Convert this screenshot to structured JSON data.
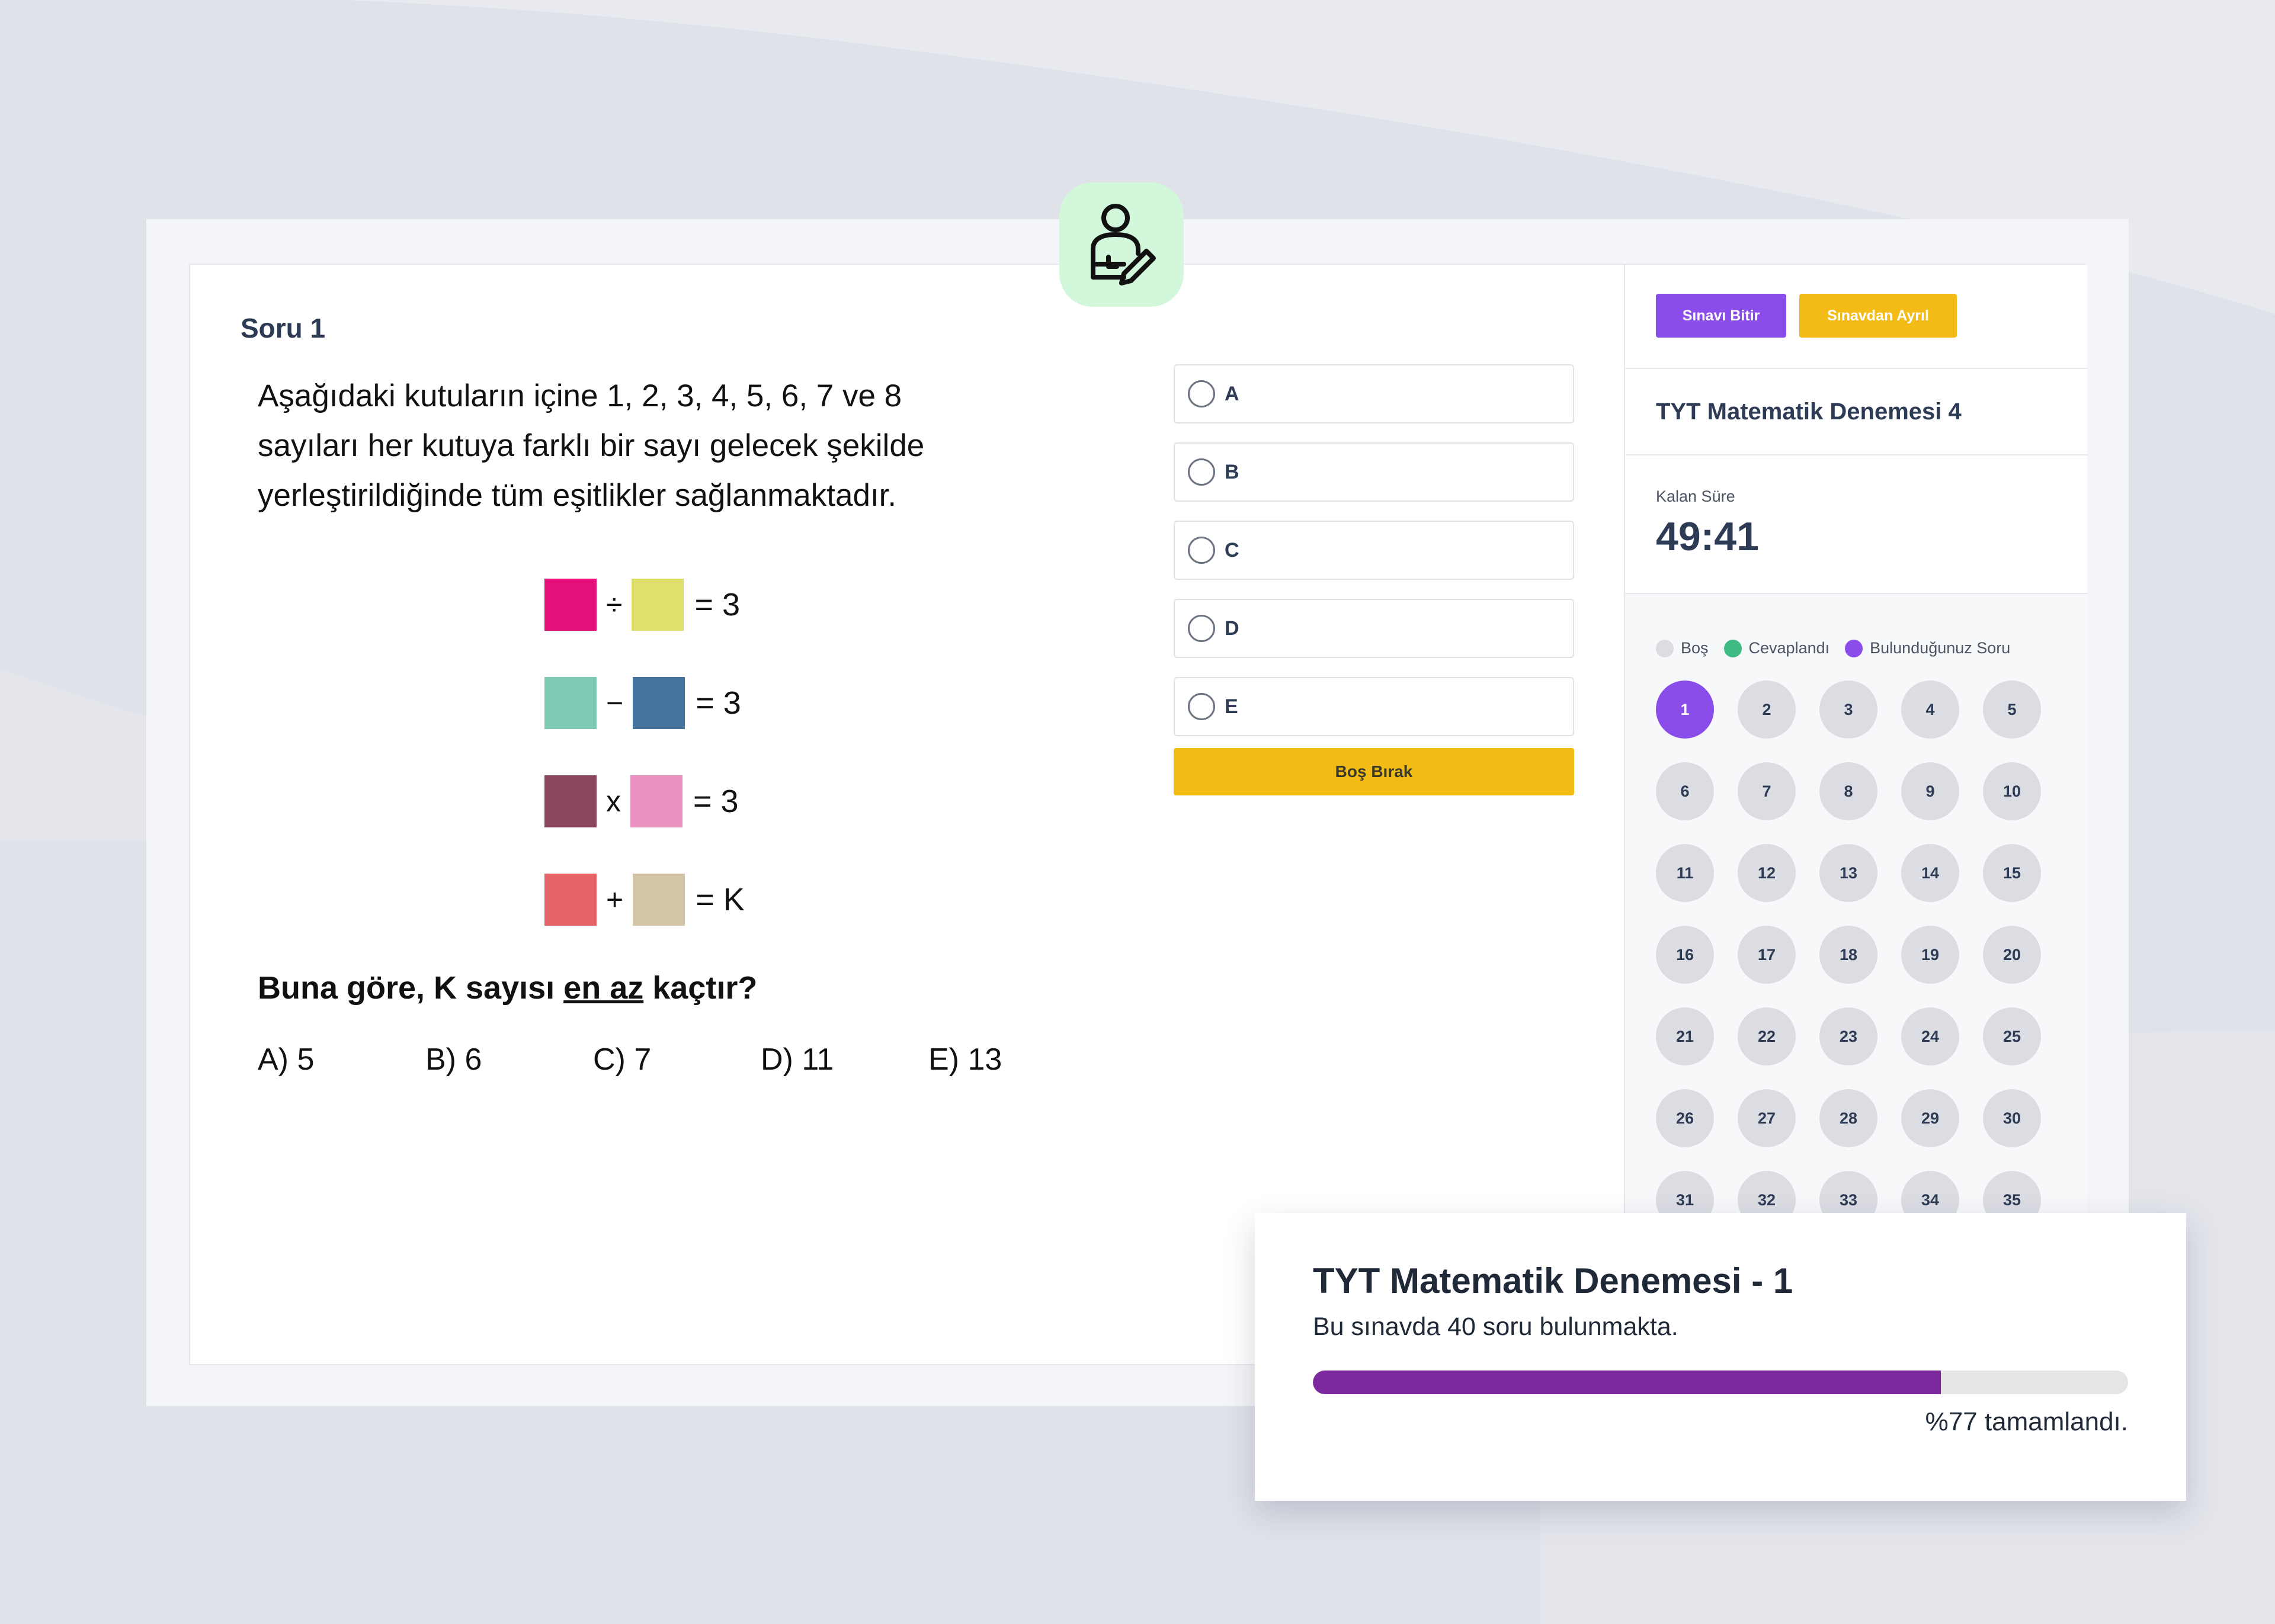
{
  "question": {
    "title": "Soru 1",
    "text": "Aşağıdaki kutuların içine 1, 2, 3, 4, 5, 6, 7 ve 8 sayıları her kutuya farklı bir sayı gelecek şekilde yerleştirildiğinde tüm eşitlikler sağlanmaktadır.",
    "equations": [
      {
        "left_color": "#e3107b",
        "op": "÷",
        "right_color": "#dfe06b",
        "result": "= 3"
      },
      {
        "left_color": "#7fc8b4",
        "op": "−",
        "right_color": "#46749f",
        "result": "= 3"
      },
      {
        "left_color": "#8b4660",
        "op": "x",
        "right_color": "#e891bf",
        "result": "= 3"
      },
      {
        "left_color": "#e46468",
        "op": "+",
        "right_color": "#d5c5a8",
        "result": "= K"
      }
    ],
    "prompt_before": "Buna göre, K sayısı ",
    "prompt_underlined": "en az",
    "prompt_after": " kaçtır?",
    "choices": [
      "A)  5",
      "B)  6",
      "C)  7",
      "D)  11",
      "E)  13"
    ]
  },
  "options": [
    "A",
    "B",
    "C",
    "D",
    "E"
  ],
  "skip_label": "Boş Bırak",
  "sidebar": {
    "finish_label": "Sınavı Bitir",
    "leave_label": "Sınavdan Ayrıl",
    "exam_title": "TYT Matematik Denemesi 4",
    "timer_label": "Kalan Süre",
    "timer_value": "49:41",
    "legend": [
      {
        "label": "Boş",
        "color": "#dcdde3"
      },
      {
        "label": "Cevaplandı",
        "color": "#3dbb82"
      },
      {
        "label": "Bulunduğunuz Soru",
        "color": "#8b4dea"
      }
    ],
    "numbers": [
      "1",
      "2",
      "3",
      "4",
      "5",
      "6",
      "7",
      "8",
      "9",
      "10",
      "11",
      "12",
      "13",
      "14",
      "15",
      "16",
      "17",
      "18",
      "19",
      "20",
      "21",
      "22",
      "23",
      "24",
      "25",
      "26",
      "27",
      "28",
      "29",
      "30",
      "31",
      "32",
      "33",
      "34",
      "35"
    ],
    "active_number": "1"
  },
  "popup": {
    "title": "TYT Matematik Denemesi - 1",
    "subtitle": "Bu sınavda 40 soru bulunmakta.",
    "progress_percent": 77,
    "progress_text": "%77 tamamlandı."
  },
  "colors": {
    "accent_purple": "#8b4dea",
    "accent_yellow": "#f3bb16",
    "progress_fill": "#7d2a9e",
    "badge_green": "#d2f7db"
  }
}
